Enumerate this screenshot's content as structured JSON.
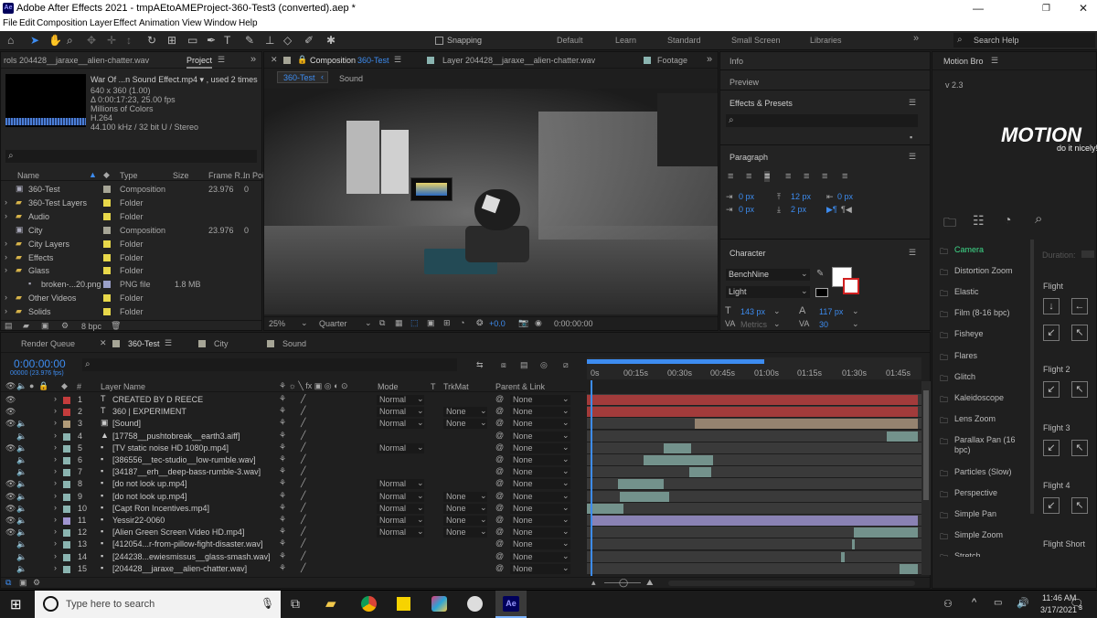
{
  "window": {
    "title": "Adobe After Effects 2021 - tmpAEtoAMEProject-360-Test3 (converted).aep *",
    "minimize": "—",
    "maximize": "❐",
    "close": "✕"
  },
  "menu": [
    "File",
    "Edit",
    "Composition",
    "Layer",
    "Effect",
    "Animation",
    "View",
    "Window",
    "Help"
  ],
  "toolbar": {
    "snapping": "Snapping",
    "workspaces": [
      "Default",
      "Learn",
      "Standard",
      "Small Screen",
      "Libraries"
    ],
    "search_help": "Search Help"
  },
  "project": {
    "left_tab": "rols 204428__jaraxe__alien-chatter.wav",
    "tab": "Project",
    "footage_name": "War Of ...n Sound Effect.mp4 ▾ , used 2 times",
    "info": [
      "640 x 360 (1.00)",
      "Δ 0:00:17:23, 25.00 fps",
      "Millions of Colors",
      "H.264",
      "44.100 kHz / 32 bit U / Stereo"
    ],
    "search_placeholder": "",
    "columns": [
      "Name",
      "Type",
      "Size",
      "Frame R...",
      "In Poi"
    ],
    "items": [
      {
        "name": "360-Test",
        "type": "Composition",
        "size": "",
        "fr": "23.976",
        "inp": "0",
        "color": "#a6a596",
        "icon": "comp"
      },
      {
        "name": "360-Test Layers",
        "type": "Folder",
        "size": "",
        "fr": "",
        "inp": "",
        "color": "#e8d84a",
        "icon": "folder"
      },
      {
        "name": "Audio",
        "type": "Folder",
        "size": "",
        "fr": "",
        "inp": "",
        "color": "#e8d84a",
        "icon": "folder"
      },
      {
        "name": "City",
        "type": "Composition",
        "size": "",
        "fr": "23.976",
        "inp": "0",
        "color": "#a6a596",
        "icon": "comp"
      },
      {
        "name": "City Layers",
        "type": "Folder",
        "size": "",
        "fr": "",
        "inp": "",
        "color": "#e8d84a",
        "icon": "folder"
      },
      {
        "name": "Effects",
        "type": "Folder",
        "size": "",
        "fr": "",
        "inp": "",
        "color": "#e8d84a",
        "icon": "folder"
      },
      {
        "name": "Glass",
        "type": "Folder",
        "size": "",
        "fr": "",
        "inp": "",
        "color": "#e8d84a",
        "icon": "folder"
      },
      {
        "name": "broken-...20.png",
        "type": "PNG file",
        "size": "1.8 MB",
        "fr": "",
        "inp": "",
        "color": "#9aa0c8",
        "icon": "file"
      },
      {
        "name": "Other Videos",
        "type": "Folder",
        "size": "",
        "fr": "",
        "inp": "",
        "color": "#e8d84a",
        "icon": "folder"
      },
      {
        "name": "Solids",
        "type": "Folder",
        "size": "",
        "fr": "",
        "inp": "",
        "color": "#e8d84a",
        "icon": "folder"
      }
    ],
    "bpc": "8 bpc"
  },
  "comp_viewer": {
    "tab": "Composition",
    "comp_name": "360-Test",
    "layer_tab": "Layer 204428__jaraxe__alien-chatter.wav",
    "footage_tab": "Footage",
    "subtabs": [
      "360-Test",
      "Sound"
    ],
    "zoom": "25%",
    "quality": "Quarter",
    "exposure": "+0.0",
    "timecode": "0:00:00:00"
  },
  "right_panels": {
    "info": "Info",
    "preview": "Preview",
    "effects": "Effects & Presets",
    "paragraph": "Paragraph",
    "para_values": [
      "0 px",
      "12 px",
      "0 px",
      "0 px",
      "2 px"
    ],
    "character": "Character",
    "font": "BenchNine",
    "style": "Light",
    "font_size": "143 px",
    "leading": "117 px",
    "tracking": "30",
    "metrics": "Metrics"
  },
  "motionbro": {
    "title": "Motion Bro",
    "version": "v 2.3",
    "logo": "MOTION",
    "tagline": "do it nicely!",
    "items": [
      "Camera",
      "Distortion Zoom",
      "Elastic",
      "Film (8-16 bpc)",
      "Fisheye",
      "Flares",
      "Glitch",
      "Kaleidoscope",
      "Lens Zoom",
      "Parallax Pan (16 bpc)",
      "Particles (Slow)",
      "Perspective",
      "Simple Pan",
      "Simple Zoom",
      "Stretch"
    ],
    "duration": "Duration:",
    "groups": [
      "Flight",
      "Flight 2",
      "Flight 3",
      "Flight 4",
      "Flight Short"
    ]
  },
  "timeline": {
    "tabs": [
      "Render Queue",
      "360-Test",
      "City",
      "Sound"
    ],
    "timecode": "0:00:00:00",
    "frame_info": "00000 (23.976 fps)",
    "columns": {
      "layer_name": "Layer Name",
      "mode": "Mode",
      "t": "T",
      "trkmat": "TrkMat",
      "parent": "Parent & Link"
    },
    "ruler": [
      "0s",
      "00:15s",
      "00:30s",
      "00:45s",
      "01:00s",
      "01:15s",
      "01:30s",
      "01:45s"
    ],
    "layers": [
      {
        "num": "1",
        "name": "CREATED BY D REECE",
        "mode": "Normal",
        "trk": "",
        "parent": "None",
        "color": "#c43c3c",
        "type": "T"
      },
      {
        "num": "2",
        "name": "360 | EXPERIMENT",
        "mode": "Normal",
        "trk": "None",
        "parent": "None",
        "color": "#c43c3c",
        "type": "T"
      },
      {
        "num": "3",
        "name": "[Sound]",
        "mode": "Normal",
        "trk": "None",
        "parent": "None",
        "color": "#b09a78",
        "type": "comp"
      },
      {
        "num": "4",
        "name": "[17758__pushtobreak__earth3.aiff]",
        "mode": "",
        "trk": "",
        "parent": "None",
        "color": "#8ab4b0",
        "type": "audio"
      },
      {
        "num": "5",
        "name": "[TV static noise HD 1080p.mp4]",
        "mode": "Normal",
        "trk": "",
        "parent": "None",
        "color": "#8ab4b0",
        "type": "file"
      },
      {
        "num": "6",
        "name": "[386556__tec-studio__low-rumble.wav]",
        "mode": "",
        "trk": "",
        "parent": "None",
        "color": "#8ab4b0",
        "type": "file"
      },
      {
        "num": "7",
        "name": "[34187__erh__deep-bass-rumble-3.wav]",
        "mode": "",
        "trk": "",
        "parent": "None",
        "color": "#8ab4b0",
        "type": "file"
      },
      {
        "num": "8",
        "name": "[do not look up.mp4]",
        "mode": "Normal",
        "trk": "",
        "parent": "None",
        "color": "#8ab4b0",
        "type": "file"
      },
      {
        "num": "9",
        "name": "[do not look up.mp4]",
        "mode": "Normal",
        "trk": "None",
        "parent": "None",
        "color": "#8ab4b0",
        "type": "file"
      },
      {
        "num": "10",
        "name": "[Capt Ron Incentives.mp4]",
        "mode": "Normal",
        "trk": "None",
        "parent": "None",
        "color": "#8ab4b0",
        "type": "file"
      },
      {
        "num": "11",
        "name": "Yessir22-0060",
        "mode": "Normal",
        "trk": "None",
        "parent": "None",
        "color": "#a095d0",
        "type": "file"
      },
      {
        "num": "12",
        "name": "[Alien Green Screen Video HD.mp4]",
        "mode": "Normal",
        "trk": "None",
        "parent": "None",
        "color": "#8ab4b0",
        "type": "file"
      },
      {
        "num": "13",
        "name": "[412054...r-from-pillow-fight-disaster.wav]",
        "mode": "",
        "trk": "",
        "parent": "None",
        "color": "#8ab4b0",
        "type": "file"
      },
      {
        "num": "14",
        "name": "[244238...ewiesmissus__glass-smash.wav]",
        "mode": "",
        "trk": "",
        "parent": "None",
        "color": "#8ab4b0",
        "type": "file"
      },
      {
        "num": "15",
        "name": "[204428__jaraxe__alien-chatter.wav]",
        "mode": "",
        "trk": "",
        "parent": "None",
        "color": "#8ab4b0",
        "type": "file"
      }
    ]
  },
  "taskbar": {
    "search_placeholder": "Type here to search",
    "time": "11:46 AM",
    "date": "3/17/2021",
    "notif": "3"
  }
}
